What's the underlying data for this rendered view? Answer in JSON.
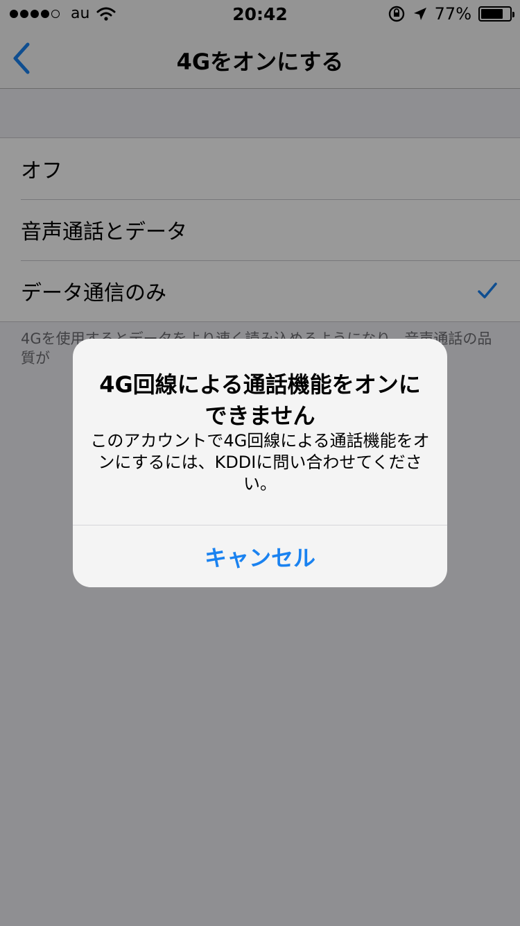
{
  "status_bar": {
    "carrier": "au",
    "time": "20:42",
    "battery_text": "77%",
    "battery_level": 0.77,
    "signal_bars_filled": 4,
    "signal_bars_total": 5
  },
  "nav": {
    "title": "4Gをオンにする",
    "back_icon": "chevron-left-icon"
  },
  "options": [
    {
      "label": "オフ",
      "selected": false
    },
    {
      "label": "音声通話とデータ",
      "selected": false
    },
    {
      "label": "データ通信のみ",
      "selected": true
    }
  ],
  "footer_note": "4Gを使用するとデータをより速く読み込めるようになり、音声通話の品質が",
  "alert": {
    "title": "4G回線による通話機能をオンにできません",
    "message": "このアカウントで4G回線による通話機能をオンにするには、KDDIに問い合わせてください。",
    "cancel_label": "キャンセル"
  },
  "colors": {
    "accent": "#1a82f0",
    "nav_background": "#f7f7f7",
    "group_background": "#efeff4"
  }
}
